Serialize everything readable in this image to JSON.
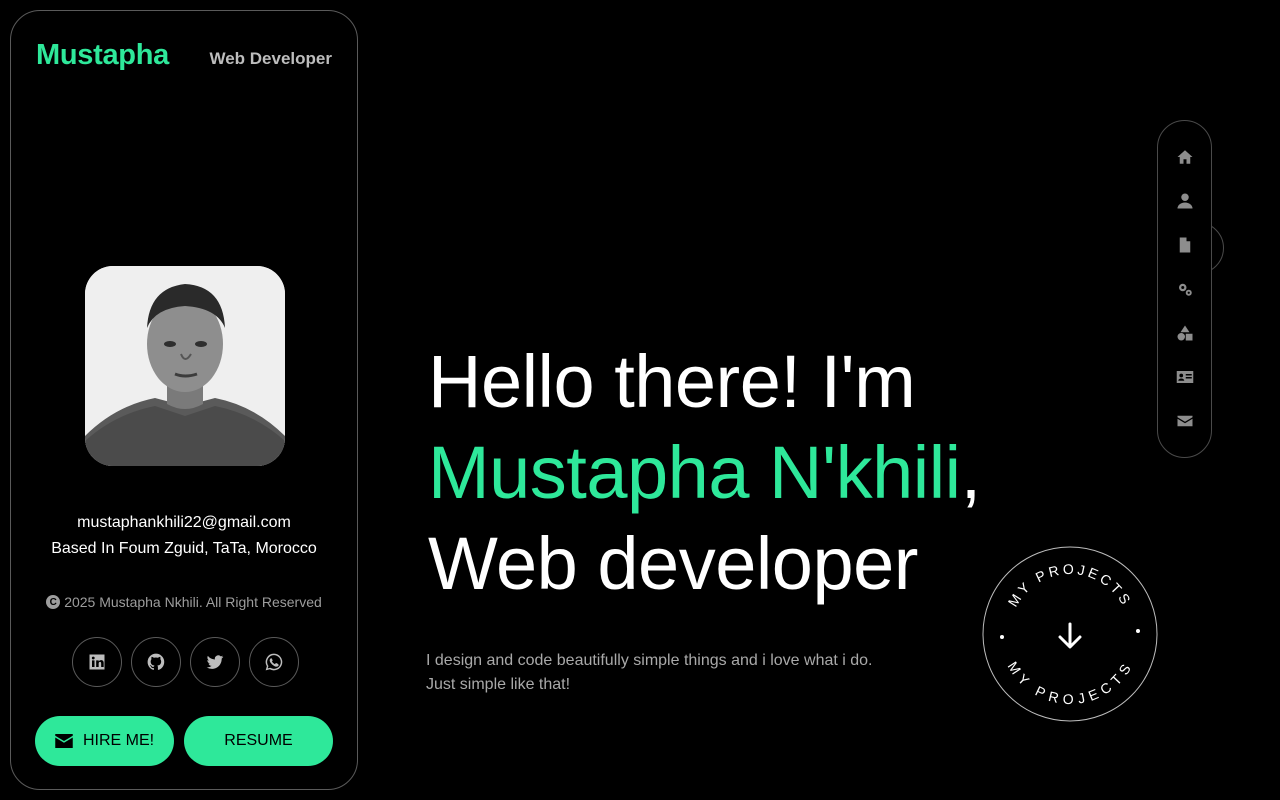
{
  "profile": {
    "name": "Mustapha",
    "role": "Web Developer",
    "email": "mustaphankhili22@gmail.com",
    "location": "Based In Foum Zguid, TaTa, Morocco",
    "copyright": "2025 Mustapha Nkhili. All Right Reserved",
    "copyright_symbol": "C"
  },
  "socials": [
    {
      "icon": "linkedin-icon"
    },
    {
      "icon": "github-icon"
    },
    {
      "icon": "twitter-icon"
    },
    {
      "icon": "whatsapp-icon"
    }
  ],
  "buttons": {
    "hire": "HIRE ME!",
    "resume": "RESUME"
  },
  "hero": {
    "line1": "Hello there! I'm",
    "name": "Mustapha N'khili",
    "comma": ",",
    "line3": "Web developer",
    "description": "I design and code beautifully simple things and i love what i do. Just simple like that!"
  },
  "nav": [
    {
      "icon": "home-icon"
    },
    {
      "icon": "user-icon"
    },
    {
      "icon": "file-icon"
    },
    {
      "icon": "gears-icon"
    },
    {
      "icon": "shapes-icon"
    },
    {
      "icon": "id-card-icon"
    },
    {
      "icon": "envelope-icon"
    }
  ],
  "badge": {
    "top_text": "MY PROJECTS",
    "bottom_text": "MY PROJECTS"
  },
  "colors": {
    "accent": "#2ee89a",
    "background": "#000000",
    "muted": "#a9a9a9"
  }
}
